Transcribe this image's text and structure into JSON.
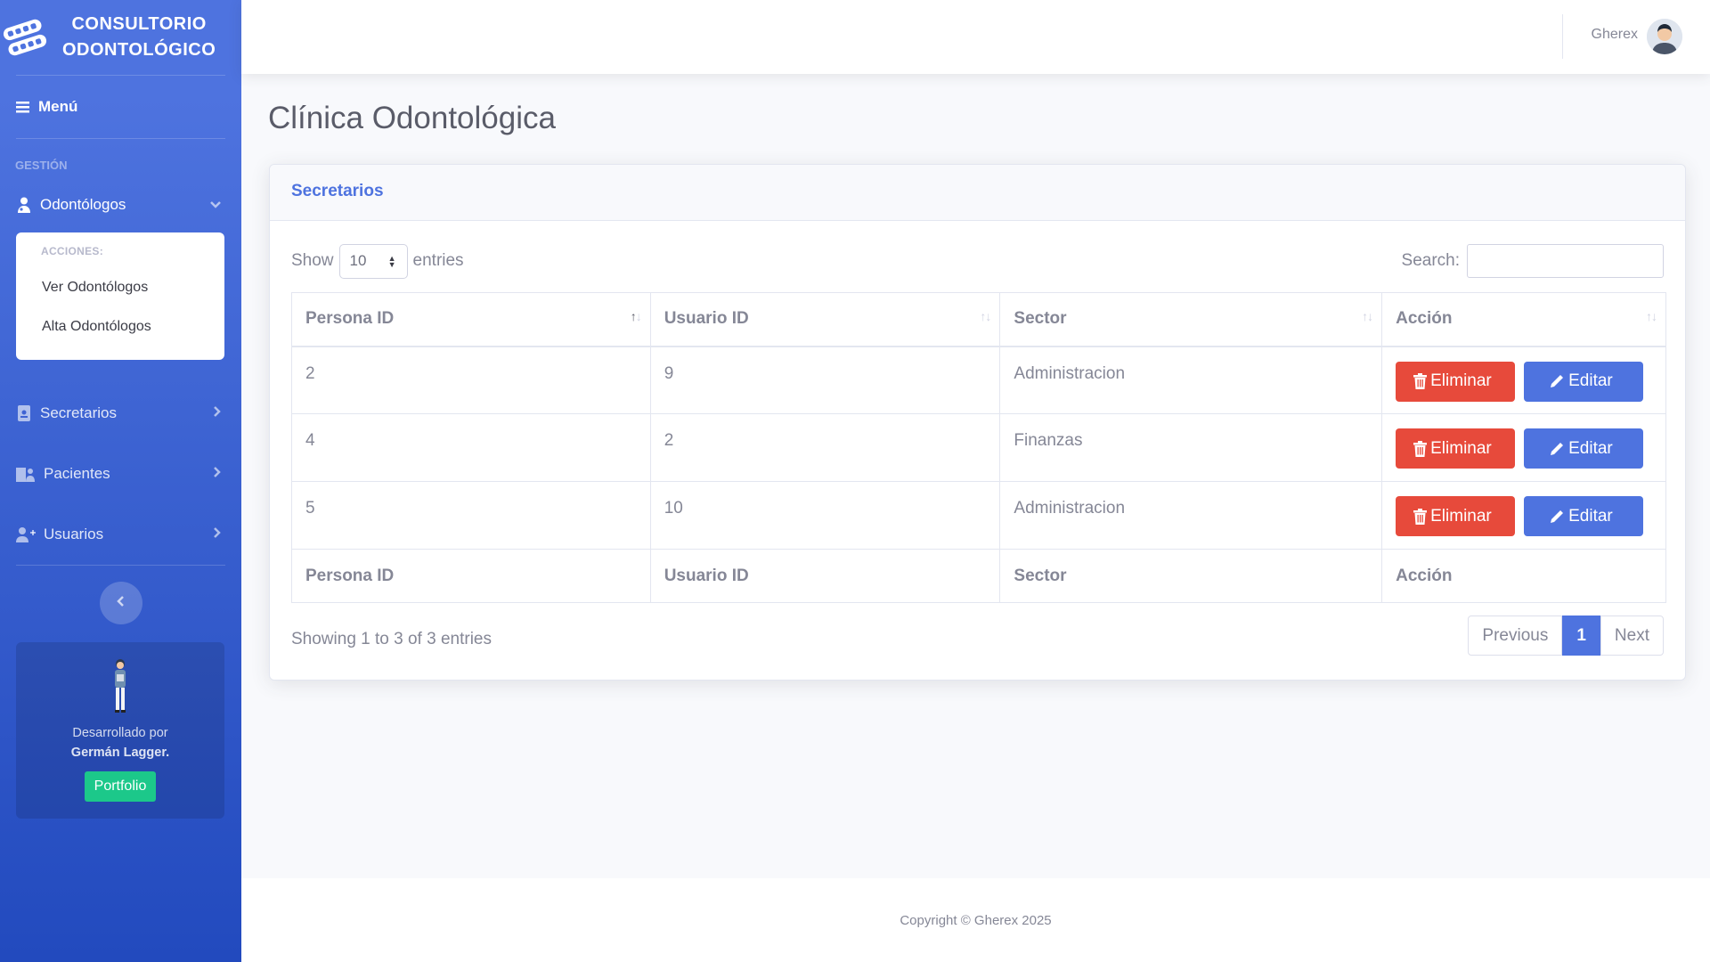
{
  "brand": {
    "line1": "CONSULTORIO",
    "line2": "ODONTOLÓGICO"
  },
  "sidebar": {
    "menu_label": "Menú",
    "heading": "GESTIÓN",
    "items": [
      {
        "label": "Odontólogos",
        "icon": "user-doctor-icon",
        "expanded": true
      },
      {
        "label": "Secretarios",
        "icon": "id-badge-icon"
      },
      {
        "label": "Pacientes",
        "icon": "hospital-user-icon"
      },
      {
        "label": "Usuarios",
        "icon": "user-plus-icon"
      }
    ],
    "submenu": {
      "heading": "ACCIONES:",
      "items": [
        "Ver Odontólogos",
        "Alta Odontólogos"
      ]
    },
    "dev_card": {
      "text": "Desarrollado por",
      "author": "Germán Lagger.",
      "button": "Portfolio"
    }
  },
  "topbar": {
    "user_name": "Gherex"
  },
  "page": {
    "title": "Clínica Odontológica"
  },
  "card": {
    "header": "Secretarios"
  },
  "table_controls": {
    "show_label": "Show",
    "entries_value": "10",
    "entries_label": "entries",
    "search_label": "Search:",
    "search_value": ""
  },
  "table": {
    "columns": [
      "Persona ID",
      "Usuario ID",
      "Sector",
      "Acción"
    ],
    "rows": [
      {
        "persona_id": "2",
        "usuario_id": "9",
        "sector": "Administracion"
      },
      {
        "persona_id": "4",
        "usuario_id": "2",
        "sector": "Finanzas"
      },
      {
        "persona_id": "5",
        "usuario_id": "10",
        "sector": "Administracion"
      }
    ],
    "delete_label": "Eliminar",
    "edit_label": "Editar"
  },
  "pagination": {
    "info": "Showing 1 to 3 of 3 entries",
    "previous": "Previous",
    "current": "1",
    "next": "Next"
  },
  "footer": {
    "copyright": "Copyright © Gherex 2025"
  },
  "colors": {
    "primary": "#4e73df",
    "danger": "#e74a3b",
    "success": "#1cc88a"
  }
}
